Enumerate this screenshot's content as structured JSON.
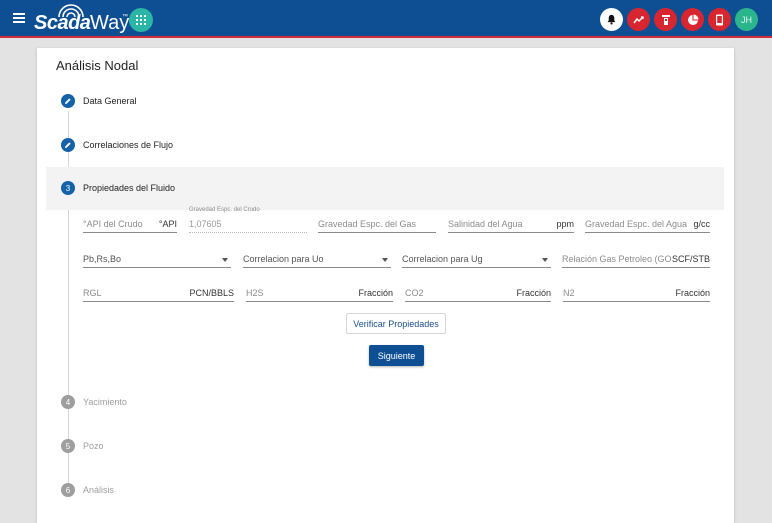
{
  "header": {
    "logo_primary": "Scada",
    "logo_secondary": "Way",
    "logo_tm": "™",
    "menu_icon": "hamburger-menu-icon",
    "apps_icon": "apps-grid-icon",
    "actions": [
      {
        "icon": "bell-icon",
        "color": "#ffffff"
      },
      {
        "icon": "trend-chart-icon",
        "color": "#d7262f"
      },
      {
        "icon": "wellhead-pump-icon",
        "color": "#d7262f"
      },
      {
        "icon": "pie-chart-icon",
        "color": "#d7262f"
      },
      {
        "icon": "mobile-device-icon",
        "color": "#d7262f"
      }
    ],
    "avatar_initials": "JH",
    "colors": {
      "bar": "#0d4f92",
      "accent_line": "#d62b3a",
      "apps": "#2bb5a6",
      "avatar": "#2bb58c"
    }
  },
  "card": {
    "title": "Análisis Nodal"
  },
  "steps": [
    {
      "marker": "edit",
      "label": "Data General",
      "state": "completed"
    },
    {
      "marker": "edit",
      "label": "Correlaciones de Flujo",
      "state": "completed"
    },
    {
      "marker": "3",
      "label": "Propiedades del Fluido",
      "state": "active"
    },
    {
      "marker": "4",
      "label": "Yacimiento",
      "state": "pending"
    },
    {
      "marker": "5",
      "label": "Pozo",
      "state": "pending"
    },
    {
      "marker": "6",
      "label": "Análisis",
      "state": "pending"
    }
  ],
  "form": {
    "api": {
      "placeholder": "°API del Crudo",
      "suffix": "°API"
    },
    "grav_crudo": {
      "label": "Gravedad Espc. del Crudo",
      "value": "1,07605"
    },
    "grav_gas": {
      "placeholder": "Gravedad Espc. del Gas"
    },
    "salinidad": {
      "placeholder": "Salinidad del Agua",
      "suffix": "ppm"
    },
    "grav_agua": {
      "placeholder": "Gravedad Espc. del Agua",
      "suffix": "g/cc"
    },
    "pbrsbo": {
      "placeholder": "Pb,Rs,Bo"
    },
    "corr_uo": {
      "placeholder": "Correlacion para Uo"
    },
    "corr_ug": {
      "placeholder": "Correlacion para Ug"
    },
    "rgp": {
      "placeholder": "Relación Gas Petroleo (GO...",
      "suffix": "SCF/STB"
    },
    "rgl": {
      "placeholder": "RGL",
      "suffix": "PCN/BBLS"
    },
    "h2s": {
      "placeholder": "H2S",
      "suffix": "Fracción"
    },
    "co2": {
      "placeholder": "CO2",
      "suffix": "Fracción"
    },
    "n2": {
      "placeholder": "N2",
      "suffix": "Fracción"
    }
  },
  "buttons": {
    "verify": "Verificar Propiedades",
    "next": "Siguiente"
  }
}
